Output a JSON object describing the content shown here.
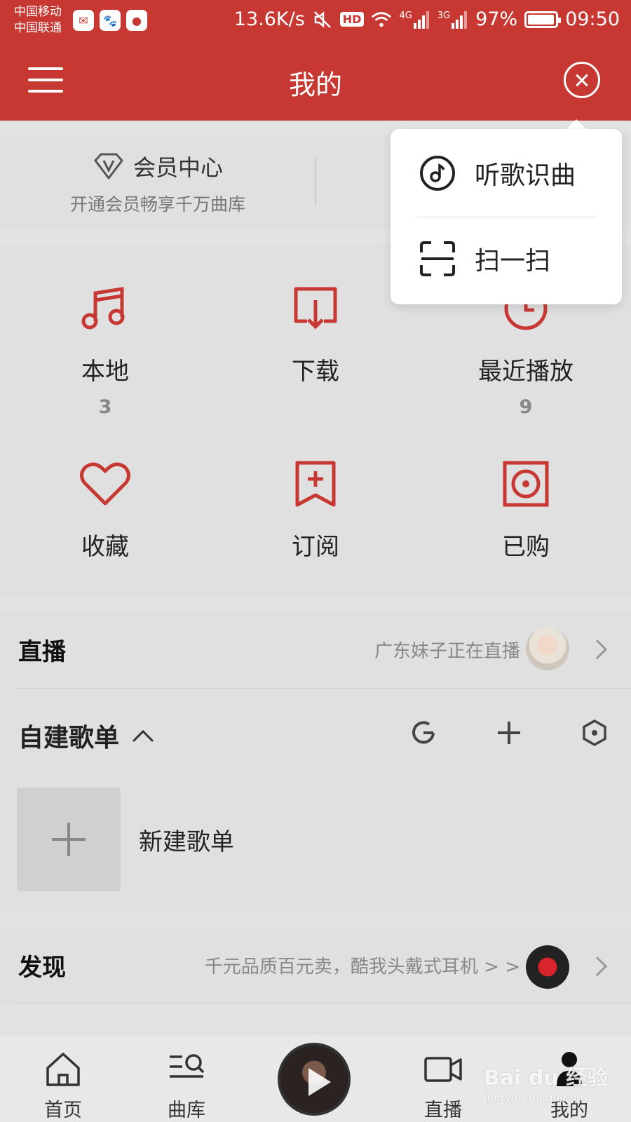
{
  "status_bar": {
    "carrier1": "中国移动",
    "carrier2": "中国联通",
    "speed": "13.6K/s",
    "hd": "HD",
    "net1": "4G",
    "net2": "3G",
    "battery": "97%",
    "battery_level": 0.97,
    "time": "09:50"
  },
  "header": {
    "title": "我的"
  },
  "member": {
    "title": "会员中心",
    "subtitle": "开通会员畅享千万曲库"
  },
  "popup": {
    "items": [
      {
        "label": "听歌识曲"
      },
      {
        "label": "扫一扫"
      }
    ]
  },
  "grid": [
    {
      "label": "本地",
      "count": "3"
    },
    {
      "label": "下载",
      "count": ""
    },
    {
      "label": "最近播放",
      "count": "9"
    },
    {
      "label": "收藏",
      "count": ""
    },
    {
      "label": "订阅",
      "count": ""
    },
    {
      "label": "已购",
      "count": ""
    }
  ],
  "live": {
    "title": "直播",
    "subtitle": "广东妹子正在直播"
  },
  "playlist": {
    "title": "自建歌单",
    "new_label": "新建歌单"
  },
  "discover": {
    "title": "发现",
    "subtitle": "千元品质百元卖，酷我头戴式耳机 > >"
  },
  "tabs": [
    {
      "label": "首页"
    },
    {
      "label": "曲库"
    },
    {
      "label": "直播"
    },
    {
      "label": "我的"
    }
  ],
  "watermark": {
    "brand": "Bai du 经验",
    "url": "jingyan.baidu.com"
  },
  "colors": {
    "brand": "#c83832",
    "icon_red": "#c83832",
    "background": "#e3e3e3"
  }
}
